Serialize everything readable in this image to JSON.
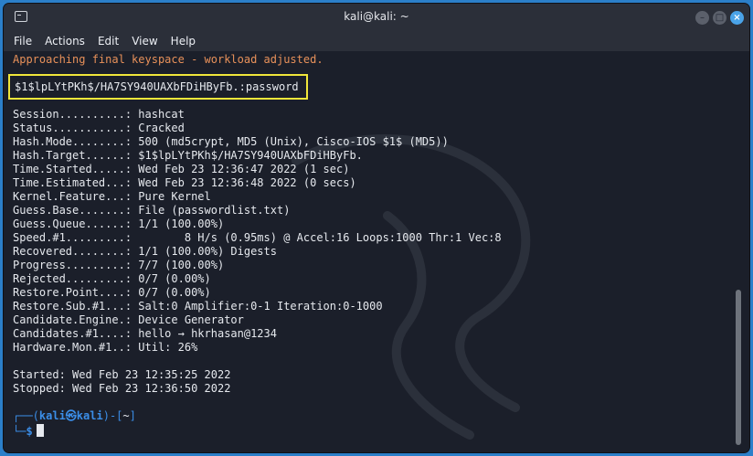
{
  "window": {
    "title": "kali@kali: ~"
  },
  "menu": [
    "File",
    "Actions",
    "Edit",
    "View",
    "Help"
  ],
  "terminal": {
    "notice": "Approaching final keyspace - workload adjusted.",
    "cracked": "$1$lpLYtPKh$/HA7SY940UAXbFDiHByFb.:password",
    "status_lines": [
      "Session..........: hashcat",
      "Status...........: Cracked",
      "Hash.Mode........: 500 (md5crypt, MD5 (Unix), Cisco-IOS $1$ (MD5))",
      "Hash.Target......: $1$lpLYtPKh$/HA7SY940UAXbFDiHByFb.",
      "Time.Started.....: Wed Feb 23 12:36:47 2022 (1 sec)",
      "Time.Estimated...: Wed Feb 23 12:36:48 2022 (0 secs)",
      "Kernel.Feature...: Pure Kernel",
      "Guess.Base.......: File (passwordlist.txt)",
      "Guess.Queue......: 1/1 (100.00%)",
      "Speed.#1.........:        8 H/s (0.95ms) @ Accel:16 Loops:1000 Thr:1 Vec:8",
      "Recovered........: 1/1 (100.00%) Digests",
      "Progress.........: 7/7 (100.00%)",
      "Rejected.........: 0/7 (0.00%)",
      "Restore.Point....: 0/7 (0.00%)",
      "Restore.Sub.#1...: Salt:0 Amplifier:0-1 Iteration:0-1000",
      "Candidate.Engine.: Device Generator",
      "Candidates.#1....: hello → hkrhasan@1234",
      "Hardware.Mon.#1..: Util: 26%"
    ],
    "started": "Started: Wed Feb 23 12:35:25 2022",
    "stopped": "Stopped: Wed Feb 23 12:36:50 2022",
    "prompt": {
      "lead": "┌──(",
      "user": "kali㉿kali",
      "mid": ")-[",
      "dir": "~",
      "end": "]",
      "lead2": "└─",
      "symbol": "$"
    }
  }
}
